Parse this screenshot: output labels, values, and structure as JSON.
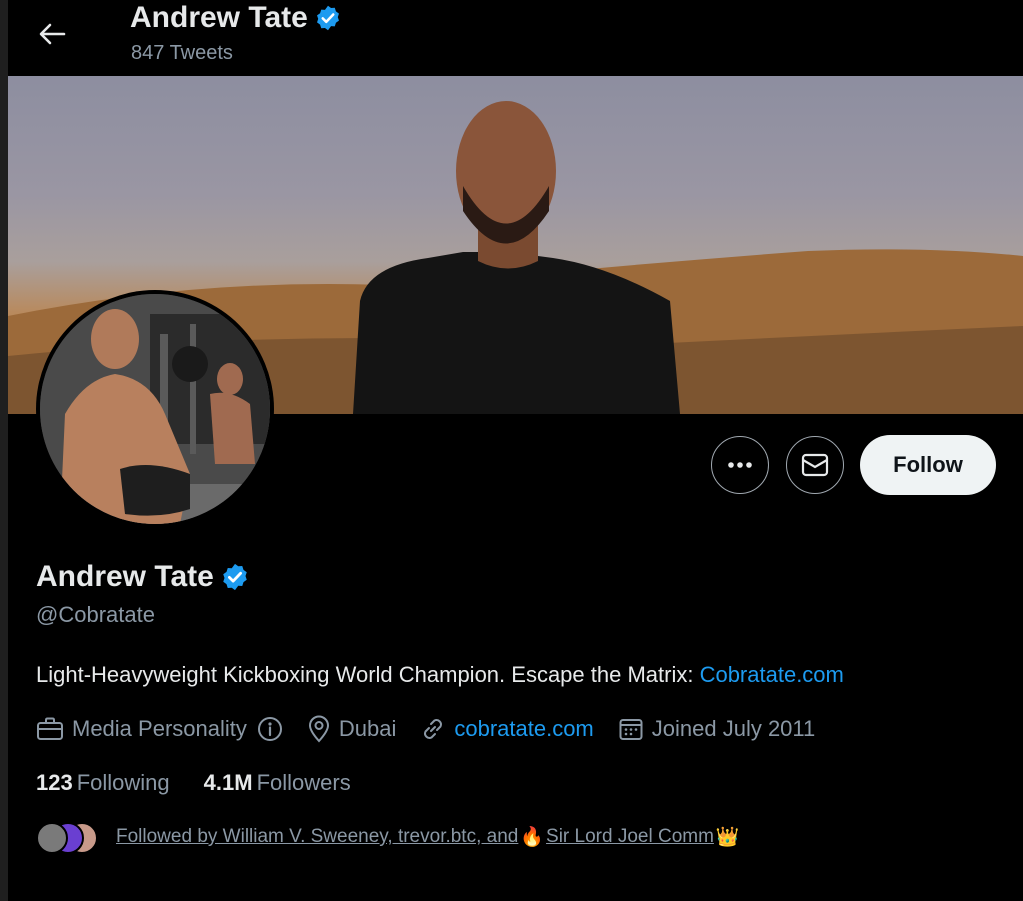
{
  "header": {
    "title": "Andrew Tate",
    "tweet_count": "847 Tweets"
  },
  "profile": {
    "name": "Andrew Tate",
    "handle": "@Cobratate",
    "bio_text": "Light-Heavyweight Kickboxing World Champion. Escape the Matrix: ",
    "bio_link": "Cobratate.com",
    "category": "Media Personality",
    "location": "Dubai",
    "website": "cobratate.com",
    "joined": "Joined July 2011",
    "following_count": "123",
    "following_label": "Following",
    "followers_count": "4.1M",
    "followers_label": "Followers",
    "followed_by_prefix": "Followed by William V. Sweeney, trevor.btc, and",
    "followed_by_last": "Sir Lord Joel Comm"
  },
  "actions": {
    "follow_label": "Follow"
  },
  "icons": {
    "back": "arrow-left-icon",
    "verified": "verified-badge-icon",
    "more": "more-dots-icon",
    "message": "envelope-icon",
    "category": "briefcase-icon",
    "info": "info-icon",
    "location": "location-pin-icon",
    "link": "link-icon",
    "calendar": "calendar-icon",
    "fire": "🔥",
    "crown": "👑"
  },
  "colors": {
    "accent": "#1d9bf0",
    "background": "#000000",
    "text": "#e7e9ea",
    "muted": "#8b98a5"
  }
}
